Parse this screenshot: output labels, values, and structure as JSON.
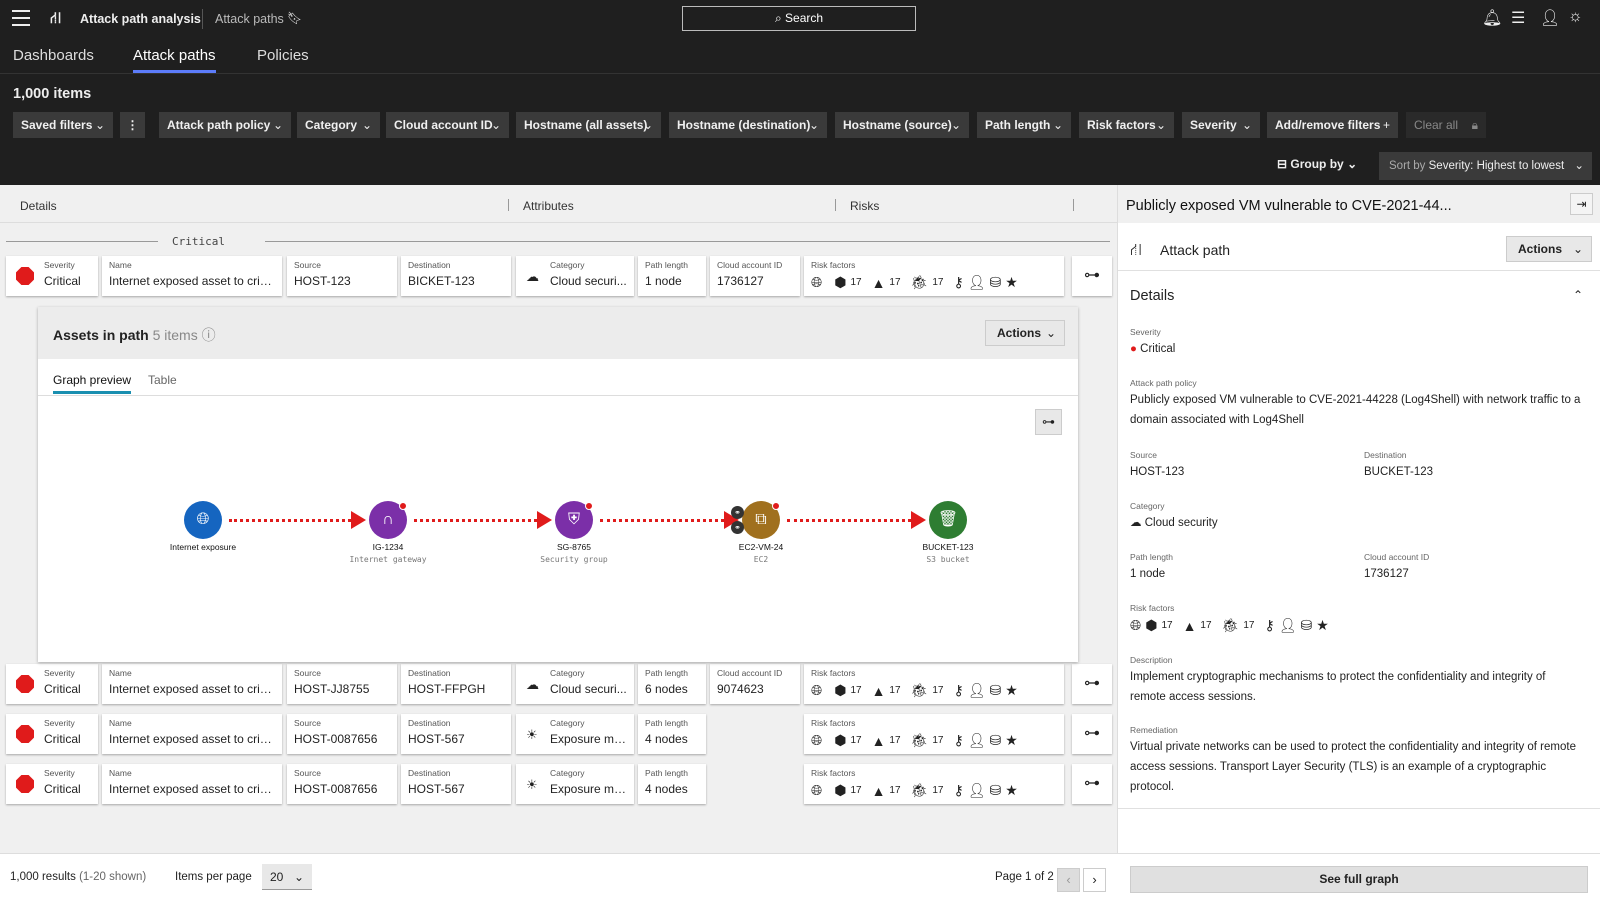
{
  "app": {
    "title": "Attack path analysis",
    "breadcrumb": "Attack paths",
    "search": "Search"
  },
  "tabs": [
    "Dashboards",
    "Attack paths",
    "Policies"
  ],
  "count": "1,000 items",
  "filters": [
    "Saved filters",
    "Attack path policy",
    "Category",
    "Cloud account ID",
    "Hostname (all assets)",
    "Hostname (destination)",
    "Hostname (source)",
    "Path length",
    "Risk factors",
    "Severity",
    "Add/remove filters",
    "Clear all"
  ],
  "group_by": "Group by",
  "sort": {
    "label": "Sort by",
    "value": "Severity: Highest to lowest"
  },
  "columns": [
    "Details",
    "Attributes",
    "Risks"
  ],
  "group_label": "Critical",
  "keys": {
    "severity": "Severity",
    "name": "Name",
    "source": "Source",
    "destination": "Destination",
    "category": "Category",
    "path_length": "Path length",
    "cloud_account": "Cloud account ID",
    "risk_factors": "Risk factors"
  },
  "risk_count": "17",
  "rows": [
    {
      "severity": "Critical",
      "name": "Internet exposed asset to criti...",
      "source": "HOST-123",
      "destination": "BICKET-123",
      "category": "Cloud securi...",
      "path_length": "1 node",
      "cloud_account": "1736127"
    },
    {
      "severity": "Critical",
      "name": "Internet exposed asset to criti...",
      "source": "HOST-JJ8755",
      "destination": "HOST-FFPGH",
      "category": "Cloud securi...",
      "path_length": "6 nodes",
      "cloud_account": "9074623"
    },
    {
      "severity": "Critical",
      "name": "Internet exposed asset to criti...",
      "source": "HOST-0087656",
      "destination": "HOST-567",
      "category": "Exposure ma...",
      "path_length": "4 nodes",
      "cloud_account": ""
    },
    {
      "severity": "Critical",
      "name": "Internet exposed asset to criti...",
      "source": "HOST-0087656",
      "destination": "HOST-567",
      "category": "Exposure ma...",
      "path_length": "4 nodes",
      "cloud_account": ""
    }
  ],
  "assets": {
    "title": "Assets in path",
    "count": "5 items",
    "actions": "Actions",
    "tabs": [
      "Graph preview",
      "Table"
    ],
    "nodes": [
      {
        "label": "Internet exposure",
        "sub": "",
        "color": "#1565c0"
      },
      {
        "label": "IG-1234",
        "sub": "Internet gateway",
        "color": "#7b2fa8"
      },
      {
        "label": "SG-8765",
        "sub": "Security group",
        "color": "#7b2fa8"
      },
      {
        "label": "EC2-VM-24",
        "sub": "EC2",
        "color": "#a0701e"
      },
      {
        "label": "BUCKET-123",
        "sub": "S3 bucket",
        "color": "#2e7d32"
      }
    ]
  },
  "detail": {
    "title": "Publicly exposed VM vulnerable to CVE-2021-44...",
    "section": "Attack path",
    "actions": "Actions",
    "details": "Details",
    "severity_k": "Severity",
    "severity": "Critical",
    "policy_k": "Attack path policy",
    "policy": "Publicly exposed VM vulnerable to CVE-2021-44228 (Log4Shell) with network traffic to a domain associated with Log4Shell",
    "source_k": "Source",
    "source": "HOST-123",
    "dest_k": "Destination",
    "dest": "BUCKET-123",
    "category_k": "Category",
    "category": "Cloud security",
    "path_k": "Path length",
    "path": "1 node",
    "acct_k": "Cloud account ID",
    "acct": "1736127",
    "risk_k": "Risk factors",
    "desc_k": "Description",
    "desc": "Implement cryptographic mechanisms to protect the confidentiality and integrity of remote access sessions.",
    "rem_k": "Remediation",
    "rem": "Virtual private networks can be used to protect the confidentiality and integrity of remote access sessions. Transport Layer Security (TLS) is an example of a cryptographic protocol.",
    "full_graph": "See full graph"
  },
  "footer": {
    "results": "1,000 results",
    "shown": "(1-20 shown)",
    "ipp": "Items per page",
    "ipp_val": "20",
    "page": "Page 1 of 2"
  }
}
